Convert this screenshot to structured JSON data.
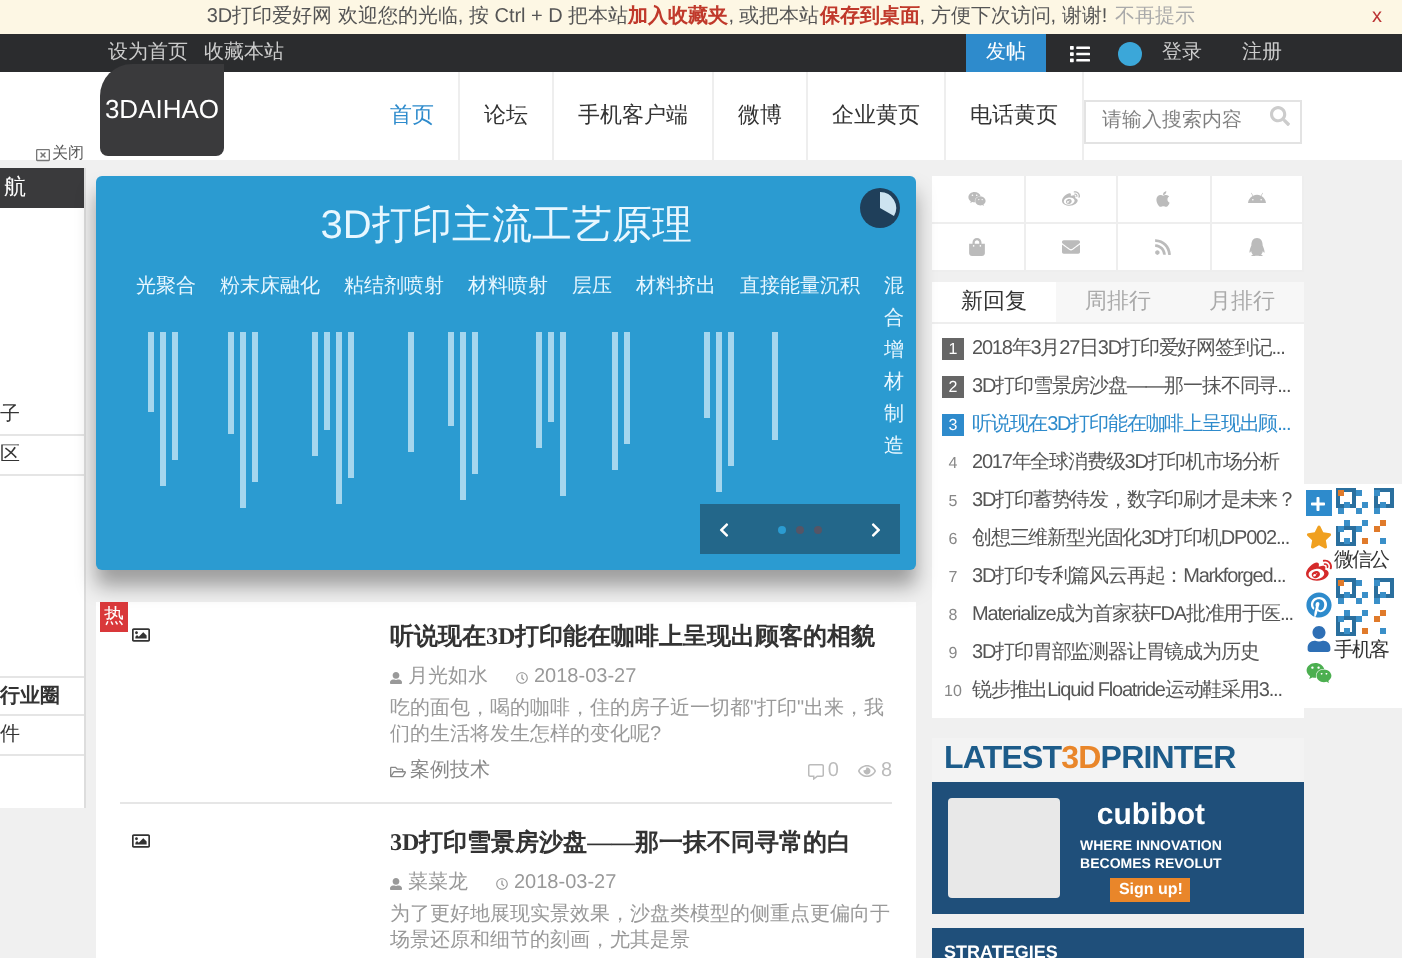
{
  "notice": {
    "segments": [
      {
        "text": "3D打印爱好网 欢迎您的光临, 按 Ctrl + D 把本站",
        "highlight": false
      },
      {
        "text": "加入收藏夹",
        "highlight": true
      },
      {
        "text": ", 或把本站",
        "highlight": false
      },
      {
        "text": "保存到桌面",
        "highlight": true
      },
      {
        "text": ", 方便下次访问, 谢谢!",
        "highlight": false
      }
    ],
    "dismiss": "不再提示",
    "close": "x"
  },
  "top_bar": {
    "links": [
      "设为首页",
      "收藏本站"
    ],
    "post_button": "发帖",
    "login": "登录",
    "register": "注册"
  },
  "logo": "3DAIHAO",
  "nav": [
    {
      "label": "首页",
      "selected": true
    },
    {
      "label": "论坛",
      "selected": false
    },
    {
      "label": "手机客户端",
      "selected": false
    },
    {
      "label": "微博",
      "selected": false
    },
    {
      "label": "企业黄页",
      "selected": false
    },
    {
      "label": "电话黄页",
      "selected": false
    }
  ],
  "search": {
    "placeholder": "请输入搜索内容"
  },
  "sidebar": {
    "close": "关闭",
    "heading": "航",
    "items": [
      "子",
      "区",
      "行业圈",
      "件"
    ]
  },
  "banner": {
    "title": "3D打印主流工艺原理",
    "categories": [
      "光聚合",
      "粉末床融化",
      "粘结剂喷射",
      "材料喷射",
      "层压",
      "材料挤出",
      "直接能量沉积"
    ],
    "vertical_category": "混合增材制造",
    "dots": [
      {
        "selected": true
      },
      {
        "selected": false
      },
      {
        "selected": false
      }
    ]
  },
  "articles": [
    {
      "hot": true,
      "hot_label": "热",
      "title": "听说现在3D打印能在咖啡上呈现出顾客的相貌",
      "author": "月光如水",
      "date": "2018-03-27",
      "summary": "吃的面包，喝的咖啡，住的房子近一切都\"打印\"出来，我们的生活将发生怎样的变化呢?",
      "category": "案例技术",
      "comments": "0",
      "views": "8"
    },
    {
      "hot": false,
      "title": "3D打印雪景房沙盘——那一抹不同寻常的白",
      "author": "菜菜龙",
      "date": "2018-03-27",
      "summary": "为了更好地展现实景效果，沙盘类模型的侧重点更偏向于场景还原和细节的刻画，尤其是景"
    }
  ],
  "rank": {
    "tabs": [
      {
        "label": "新回复",
        "selected": true
      },
      {
        "label": "周排行",
        "selected": false
      },
      {
        "label": "月排行",
        "selected": false
      }
    ],
    "items": [
      {
        "number": "1",
        "kind": "top",
        "selected": false,
        "title": "2018年3月27日3D打印爱好网签到记..."
      },
      {
        "number": "2",
        "kind": "top",
        "selected": false,
        "title": "3D打印雪景房沙盘——那一抹不同寻..."
      },
      {
        "number": "3",
        "kind": "top",
        "selected": true,
        "title": "听说现在3D打印能在咖啡上呈现出顾..."
      },
      {
        "number": "4",
        "kind": "plain",
        "selected": false,
        "title": "2017年全球消费级3D打印机市场分析"
      },
      {
        "number": "5",
        "kind": "plain",
        "selected": false,
        "title": "3D打印蓄势待发，数字印刷才是未来？"
      },
      {
        "number": "6",
        "kind": "plain",
        "selected": false,
        "title": "创想三维新型光固化3D打印机DP002..."
      },
      {
        "number": "7",
        "kind": "plain",
        "selected": false,
        "title": "3D打印专利篇风云再起：Markforged..."
      },
      {
        "number": "8",
        "kind": "plain",
        "selected": false,
        "title": "Materialize成为首家获FDA批准用于医..."
      },
      {
        "number": "9",
        "kind": "plain",
        "selected": false,
        "title": "3D打印胃部监测器让胃镜成为历史"
      },
      {
        "number": "10",
        "kind": "plain",
        "selected": false,
        "title": "锐步推出Liquid Floatride运动鞋采用3..."
      }
    ]
  },
  "ad": {
    "heading_start": "LATEST",
    "heading_accent": "3D",
    "heading_end": "PRINTER",
    "brand": "cubibot",
    "tagline_1": "WHERE INNOVATION",
    "tagline_2": "BECOMES REVOLUT",
    "cta": "Sign up!"
  },
  "ad_2": {
    "heading": "STRATEGIES"
  },
  "float_bar": {
    "qr_labels": [
      "微信公",
      "手机客"
    ]
  }
}
